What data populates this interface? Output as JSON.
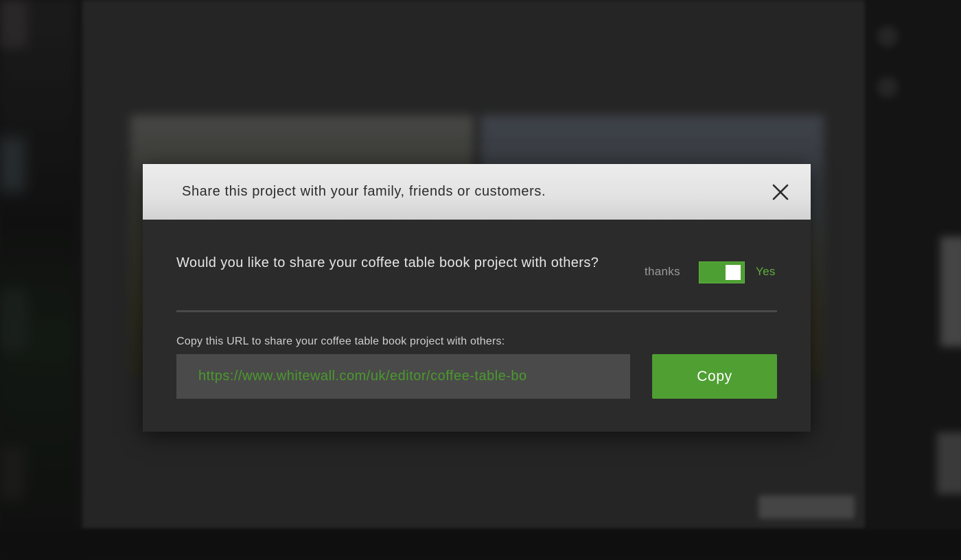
{
  "dialog": {
    "title": "Share this project with your family, friends or customers.",
    "close_icon": "close-icon",
    "question": "Would you like to share your coffee table book project with others?",
    "toggle": {
      "off_label": "thanks",
      "on_label": "Yes",
      "state": "on",
      "accent_color": "#4e9f33"
    },
    "url_label": "Copy this URL to share your coffee table book project with others:",
    "url_value": "https://www.whitewall.com/uk/editor/coffee-table-bo",
    "copy_label": "Copy"
  }
}
